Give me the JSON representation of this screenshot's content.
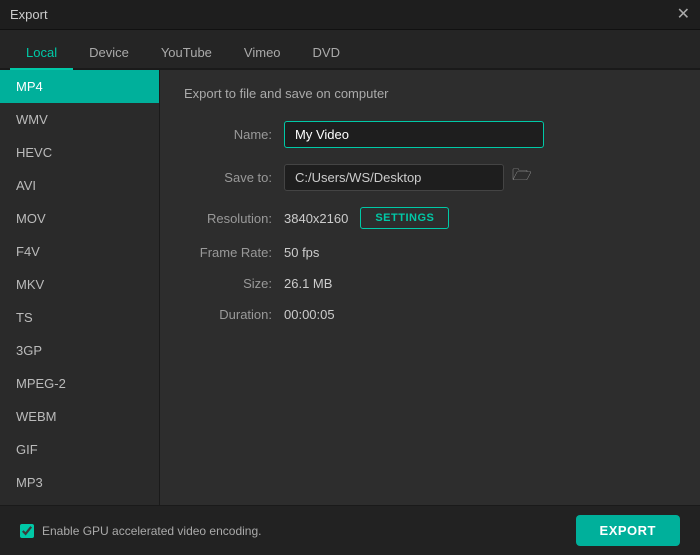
{
  "titleBar": {
    "title": "Export",
    "closeLabel": "✕"
  },
  "tabs": [
    {
      "id": "local",
      "label": "Local",
      "active": true
    },
    {
      "id": "device",
      "label": "Device",
      "active": false
    },
    {
      "id": "youtube",
      "label": "YouTube",
      "active": false
    },
    {
      "id": "vimeo",
      "label": "Vimeo",
      "active": false
    },
    {
      "id": "dvd",
      "label": "DVD",
      "active": false
    }
  ],
  "sidebar": {
    "items": [
      {
        "id": "mp4",
        "label": "MP4",
        "active": true
      },
      {
        "id": "wmv",
        "label": "WMV",
        "active": false
      },
      {
        "id": "hevc",
        "label": "HEVC",
        "active": false
      },
      {
        "id": "avi",
        "label": "AVI",
        "active": false
      },
      {
        "id": "mov",
        "label": "MOV",
        "active": false
      },
      {
        "id": "f4v",
        "label": "F4V",
        "active": false
      },
      {
        "id": "mkv",
        "label": "MKV",
        "active": false
      },
      {
        "id": "ts",
        "label": "TS",
        "active": false
      },
      {
        "id": "3gp",
        "label": "3GP",
        "active": false
      },
      {
        "id": "mpeg2",
        "label": "MPEG-2",
        "active": false
      },
      {
        "id": "webm",
        "label": "WEBM",
        "active": false
      },
      {
        "id": "gif",
        "label": "GIF",
        "active": false
      },
      {
        "id": "mp3",
        "label": "MP3",
        "active": false
      }
    ]
  },
  "content": {
    "sectionTitle": "Export to file and save on computer",
    "nameLabel": "Name:",
    "nameValue": "My Video",
    "saveToLabel": "Save to:",
    "saveToPath": "C:/Users/WS/Desktop",
    "resolutionLabel": "Resolution:",
    "resolutionValue": "3840x2160",
    "settingsButtonLabel": "SETTINGS",
    "frameRateLabel": "Frame Rate:",
    "frameRateValue": "50 fps",
    "sizeLabel": "Size:",
    "sizeValue": "26.1 MB",
    "durationLabel": "Duration:",
    "durationValue": "00:00:05"
  },
  "bottomBar": {
    "gpuLabel": "Enable GPU accelerated video encoding.",
    "exportButtonLabel": "EXPORT"
  }
}
